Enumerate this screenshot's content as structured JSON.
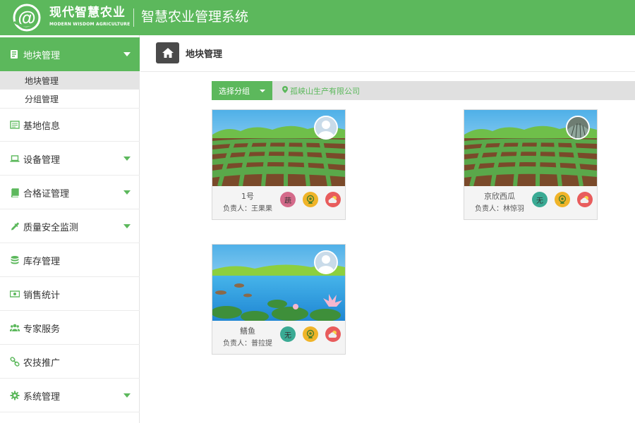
{
  "header": {
    "logo_cn": "现代智慧农业",
    "logo_en": "MODERN WISDOM AGRICULTURE",
    "system_title": "智慧农业管理系统"
  },
  "sidebar": {
    "active": {
      "label": "地块管理",
      "icon": "plot-icon"
    },
    "sub_items": [
      {
        "label": "地块管理",
        "selected": true
      },
      {
        "label": "分组管理",
        "selected": false
      }
    ],
    "items": [
      {
        "label": "基地信息",
        "icon": "base-info-icon",
        "has_caret": false
      },
      {
        "label": "设备管理",
        "icon": "laptop-icon",
        "has_caret": true
      },
      {
        "label": "合格证管理",
        "icon": "book-icon",
        "has_caret": true
      },
      {
        "label": "质量安全监测",
        "icon": "dropper-icon",
        "has_caret": true
      },
      {
        "label": "库存管理",
        "icon": "database-icon",
        "has_caret": false
      },
      {
        "label": "销售统计",
        "icon": "money-icon",
        "has_caret": false
      },
      {
        "label": "专家服务",
        "icon": "users-icon",
        "has_caret": false
      },
      {
        "label": "农技推广",
        "icon": "link-icon",
        "has_caret": false
      },
      {
        "label": "系统管理",
        "icon": "gear-icon",
        "has_caret": true
      }
    ]
  },
  "main": {
    "page_title": "地块管理",
    "filter": {
      "group_button": "选择分组",
      "company": "孤峡山生产有限公司"
    },
    "cards": [
      {
        "name": "1号",
        "owner": "负责人：王果果",
        "badge_text": "蔬",
        "badge_color": "pink",
        "scene": "field",
        "avatar": "placeholder"
      },
      {
        "name": "京欣西瓜",
        "owner": "负责人：林惊羽",
        "badge_text": "无",
        "badge_color": "teal",
        "scene": "field",
        "avatar": "photo"
      },
      {
        "name": "鳝鱼",
        "owner": "负责人：普拉提",
        "badge_text": "无",
        "badge_color": "teal",
        "scene": "pond",
        "avatar": "placeholder"
      }
    ]
  },
  "colors": {
    "primary": "#5cb85c",
    "dark": "#4a4a4a"
  }
}
